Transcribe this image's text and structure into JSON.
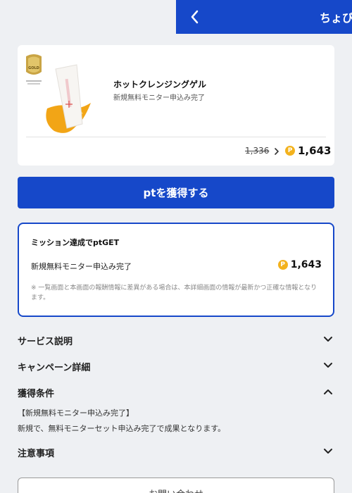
{
  "header": {
    "title": "ちょび"
  },
  "product": {
    "name": "ホットクレンジングゲル",
    "status": "新規無料モニター申込み完了",
    "badge_text": "GOLD",
    "old_price": "1,336",
    "new_price": "1,643",
    "coin_symbol": "P"
  },
  "cta": {
    "label": "ptを獲得する"
  },
  "mission": {
    "title": "ミッション達成でptGET",
    "item_label": "新規無料モニター申込み完了",
    "price": "1,643",
    "note": "※ 一覧画面と本画面の報酬情報に差異がある場合は、本詳細画面の情報が最新かつ正確な情報となります。"
  },
  "sections": {
    "service": "サービス説明",
    "campaign": "キャンペーン詳細",
    "conditions": "獲得条件",
    "notes": "注意事項"
  },
  "conditions": {
    "label": "【新規無料モニター申込み完了】",
    "text": "新規で、無料モニターセット申込み完了で成果となります。"
  },
  "bottom_button": {
    "label": "お問い合わせ"
  },
  "colors": {
    "brand": "#1648c9",
    "coin": "#f3b21d",
    "background": "#eef0f3"
  },
  "icons": {
    "back": "chevron-left-icon",
    "coin": "point-coin-icon",
    "expand": "chevron-down-icon",
    "collapse": "chevron-up-icon"
  }
}
